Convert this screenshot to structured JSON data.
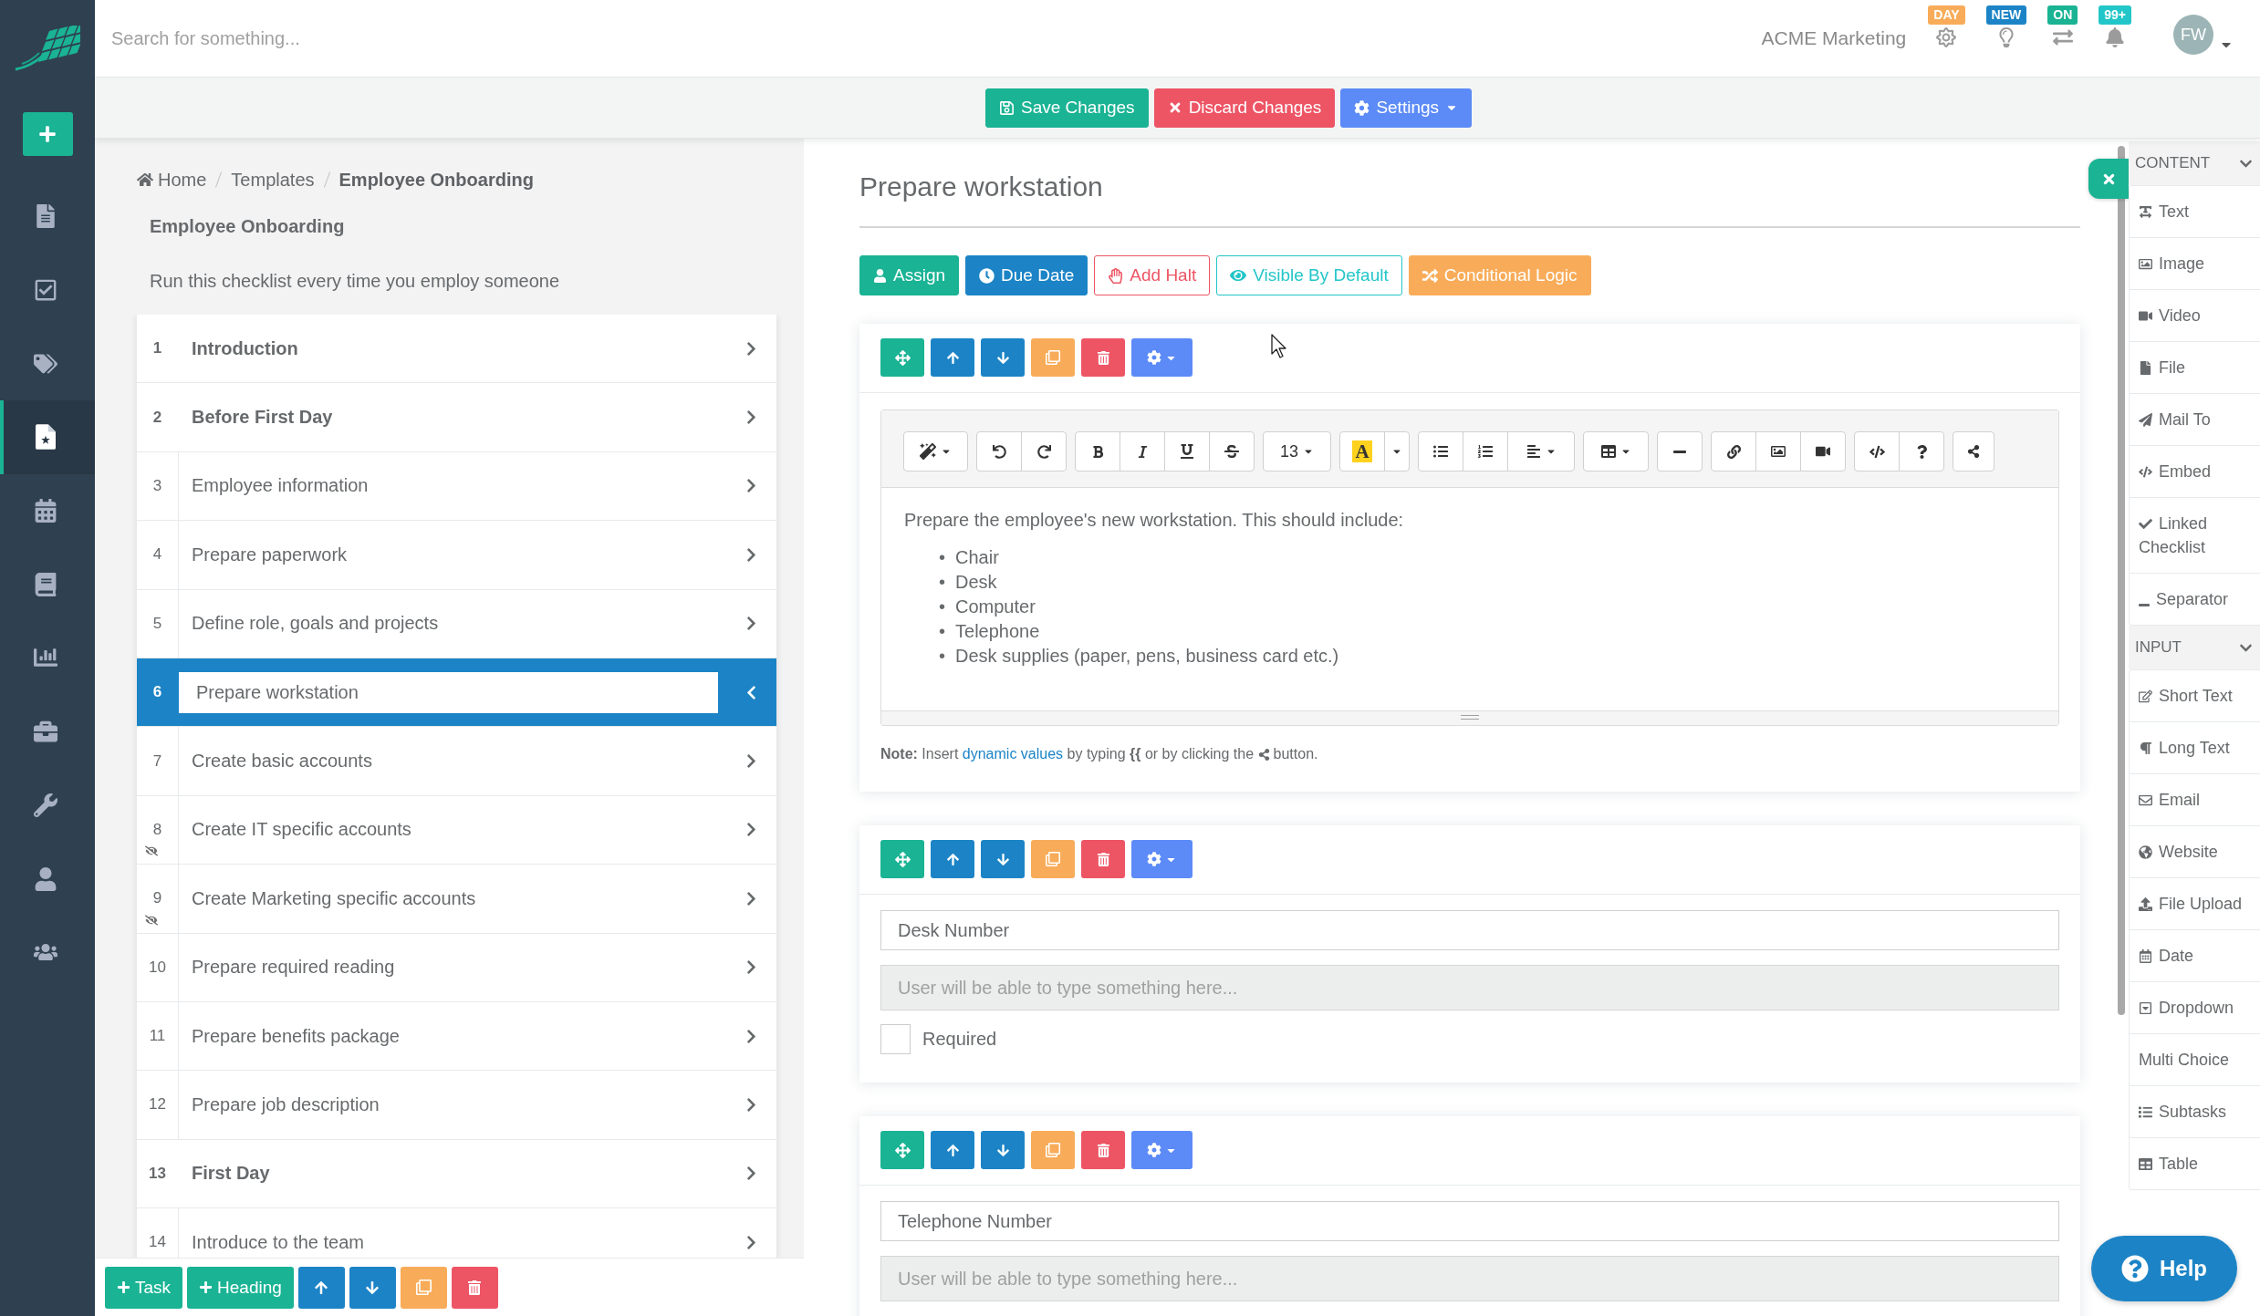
{
  "sidebar": {
    "items": [
      {
        "kind": "filelist",
        "selected": false
      },
      {
        "kind": "checksquare",
        "selected": false
      },
      {
        "kind": "tags",
        "selected": false
      },
      {
        "kind": "filestar",
        "selected": true
      },
      {
        "kind": "calendar",
        "selected": false
      },
      {
        "kind": "book",
        "selected": false
      },
      {
        "kind": "chart",
        "selected": false
      },
      {
        "kind": "briefcase",
        "selected": false
      },
      {
        "kind": "wrench",
        "selected": false
      },
      {
        "kind": "user",
        "selected": false
      },
      {
        "kind": "users",
        "selected": false
      }
    ]
  },
  "top_bar": {
    "search": {
      "placeholder": "Search for something..."
    },
    "organization": "ACME Marketing",
    "notifications": [
      {
        "kind": "sun",
        "badge": "DAY",
        "color": "#f8ac59"
      },
      {
        "kind": "bulb",
        "badge": "NEW",
        "color": "#1c84c6"
      },
      {
        "kind": "exchange",
        "badge": "ON",
        "color": "#1ab394"
      },
      {
        "kind": "bell",
        "badge": "99+",
        "color": "#23c6c8"
      }
    ],
    "user": {
      "initials": "FW"
    }
  },
  "action_bar": {
    "buttons": [
      {
        "kind": "save",
        "label": "Save Changes"
      },
      {
        "kind": "discard",
        "label": "Discard Changes"
      },
      {
        "kind": "settings",
        "label": "Settings"
      }
    ]
  },
  "checklist": {
    "breadcrumb": [
      {
        "kind": "home",
        "label": "Home"
      },
      {
        "kind": "link",
        "label": "Templates"
      },
      {
        "kind": "current",
        "label": "Employee Onboarding"
      }
    ],
    "title": "Employee Onboarding",
    "description": "Run this checklist every time you employ someone",
    "rows": [
      {
        "number": "1",
        "label": "Introduction",
        "kind": "heading",
        "selected": false,
        "hidden": false
      },
      {
        "number": "2",
        "label": "Before First Day",
        "kind": "heading",
        "selected": false,
        "hidden": false
      },
      {
        "number": "3",
        "label": "Employee information",
        "kind": "task",
        "selected": false,
        "hidden": false
      },
      {
        "number": "4",
        "label": "Prepare paperwork",
        "kind": "task",
        "selected": false,
        "hidden": false
      },
      {
        "number": "5",
        "label": "Define role, goals and projects",
        "kind": "task",
        "selected": false,
        "hidden": false
      },
      {
        "number": "6",
        "label": "Prepare workstation",
        "kind": "task",
        "selected": true,
        "hidden": false
      },
      {
        "number": "7",
        "label": "Create basic accounts",
        "kind": "task",
        "selected": false,
        "hidden": false
      },
      {
        "number": "8",
        "label": "Create IT specific accounts",
        "kind": "task",
        "selected": false,
        "hidden": true
      },
      {
        "number": "9",
        "label": "Create Marketing specific accounts",
        "kind": "task",
        "selected": false,
        "hidden": true
      },
      {
        "number": "10",
        "label": "Prepare required reading",
        "kind": "task",
        "selected": false,
        "hidden": false
      },
      {
        "number": "11",
        "label": "Prepare benefits package",
        "kind": "task",
        "selected": false,
        "hidden": false
      },
      {
        "number": "12",
        "label": "Prepare job description",
        "kind": "task",
        "selected": false,
        "hidden": false
      },
      {
        "number": "13",
        "label": "First Day",
        "kind": "heading",
        "selected": false,
        "hidden": false
      },
      {
        "number": "14",
        "label": "Introduce to the team",
        "kind": "task",
        "selected": false,
        "hidden": false
      }
    ],
    "toolbar": [
      "Task",
      "Heading"
    ]
  },
  "task": {
    "title": "Prepare workstation",
    "buttons": [
      {
        "kind": "assign",
        "label": "Assign",
        "color": "#1ab394"
      },
      {
        "kind": "due",
        "label": "Due Date",
        "color": "#1c84c6"
      },
      {
        "kind": "halt",
        "label": "Add Halt",
        "color": "#ed5565"
      },
      {
        "kind": "visible",
        "label": "Visible By Default",
        "color": "#23c6c8"
      },
      {
        "kind": "logic",
        "label": "Conditional Logic",
        "color": "#f8ac59"
      }
    ],
    "blocks": [
      {
        "kind": "text",
        "editor": {
          "font_size": "13",
          "font_color": "A"
        },
        "paragraph": "Prepare the employee's new workstation. This should include:",
        "items": [
          {
            "marker": "•",
            "text": "Chair"
          },
          {
            "marker": "•",
            "text": "Desk"
          },
          {
            "marker": "•",
            "text": "Computer"
          },
          {
            "marker": "•",
            "text": "Telephone"
          },
          {
            "marker": "•",
            "text": "Desk supplies (paper, pens, business card etc.)"
          }
        ],
        "note": {
          "lead": "**Note:** Insert",
          "link": "dynamic values",
          "middle": "by typing **{{** or by clicking the",
          "tail": "button."
        }
      },
      {
        "kind": "input",
        "label": "Desk Number",
        "placeholder": "User will be able to type something here...",
        "required": {
          "label": "Required",
          "checked": false
        }
      },
      {
        "kind": "input",
        "label": "Telephone Number",
        "placeholder": "User will be able to type something here..."
      }
    ]
  },
  "palette": {
    "sections": [
      {
        "title": "CONTENT",
        "expanded": true,
        "items": [
          {
            "kind": "text",
            "label": "Text"
          },
          {
            "kind": "image",
            "label": "Image"
          },
          {
            "kind": "video",
            "label": "Video"
          },
          {
            "kind": "file",
            "label": "File"
          },
          {
            "kind": "mail",
            "label": "Mail To"
          },
          {
            "kind": "embed",
            "label": "Embed"
          },
          {
            "kind": "checklist",
            "label": "Linked Checklist"
          },
          {
            "kind": "separator",
            "label": "Separator"
          }
        ]
      },
      {
        "title": "INPUT",
        "expanded": true,
        "items": [
          {
            "kind": "shorttext",
            "label": "Short Text"
          },
          {
            "kind": "longtext",
            "label": "Long Text"
          },
          {
            "kind": "email",
            "label": "Email"
          },
          {
            "kind": "website",
            "label": "Website"
          },
          {
            "kind": "upload",
            "label": "File Upload"
          },
          {
            "kind": "date",
            "label": "Date"
          },
          {
            "kind": "dropdown",
            "label": "Dropdown"
          },
          {
            "kind": "choice",
            "label": "Multi Choice"
          },
          {
            "kind": "subtasks",
            "label": "Subtasks"
          },
          {
            "kind": "table",
            "label": "Table"
          }
        ]
      }
    ]
  },
  "help": {
    "label": "Help"
  }
}
